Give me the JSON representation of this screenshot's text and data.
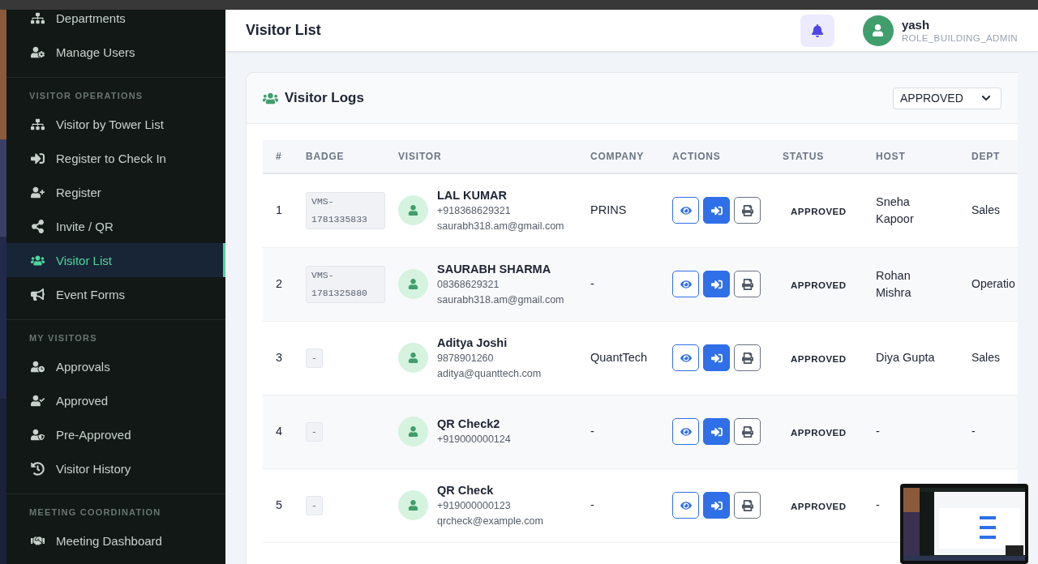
{
  "sidebar": {
    "sections": [
      {
        "items": [
          {
            "label": "Departments",
            "selected": false
          },
          {
            "label": "Manage Users",
            "selected": false
          }
        ]
      },
      {
        "heading": "VISITOR OPERATIONS",
        "items": [
          {
            "label": "Visitor by Tower List",
            "selected": false
          },
          {
            "label": "Register to Check In",
            "selected": false
          },
          {
            "label": "Register",
            "selected": false
          },
          {
            "label": "Invite / QR",
            "selected": false
          },
          {
            "label": "Visitor List",
            "selected": true
          },
          {
            "label": "Event Forms",
            "selected": false
          }
        ]
      },
      {
        "heading": "MY VISITORS",
        "items": [
          {
            "label": "Approvals",
            "selected": false
          },
          {
            "label": "Approved",
            "selected": false
          },
          {
            "label": "Pre-Approved",
            "selected": false
          },
          {
            "label": "Visitor History",
            "selected": false
          }
        ]
      },
      {
        "heading": "MEETING COORDINATION",
        "items": [
          {
            "label": "Meeting Dashboard",
            "selected": false
          }
        ]
      }
    ]
  },
  "header": {
    "title": "Visitor List",
    "user": {
      "name": "yash",
      "role": "ROLE_BUILDING_ADMIN"
    }
  },
  "card": {
    "title": "Visitor Logs",
    "filter": {
      "value": "APPROVED"
    },
    "table": {
      "columns": [
        "#",
        "BADGE",
        "VISITOR",
        "COMPANY",
        "ACTIONS",
        "STATUS",
        "HOST",
        "DEPT"
      ],
      "rows": [
        {
          "num": "1",
          "badge": "VMS-1781335833",
          "name": "LAL KUMAR",
          "phone": "+918368629321",
          "email": "saurabh318.am@gmail.com",
          "company": "PRINS",
          "status": "APPROVED",
          "host": "Sneha Kapoor",
          "dept": "Sales"
        },
        {
          "num": "2",
          "badge": "VMS-1781325880",
          "name": "SAURABH SHARMA",
          "phone": "08368629321",
          "email": "saurabh318.am@gmail.com",
          "company": "-",
          "status": "APPROVED",
          "host": "Rohan Mishra",
          "dept": "Operatio"
        },
        {
          "num": "3",
          "badge": "-",
          "name": "Aditya Joshi",
          "phone": "9878901260",
          "email": "aditya@quanttech.com",
          "company": "QuantTech",
          "status": "APPROVED",
          "host": "Diya Gupta",
          "dept": "Sales"
        },
        {
          "num": "4",
          "badge": "-",
          "name": "QR Check2",
          "phone": "+919000000124",
          "company": "-",
          "status": "APPROVED",
          "host": "-",
          "dept": "-"
        },
        {
          "num": "5",
          "badge": "-",
          "name": "QR Check",
          "phone": "+919000000123",
          "email": "qrcheck@example.com",
          "company": "-",
          "status": "APPROVED",
          "host": "-"
        }
      ]
    }
  }
}
